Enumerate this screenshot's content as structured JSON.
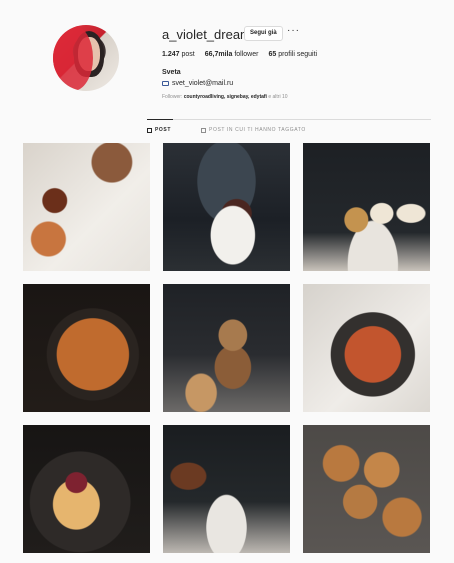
{
  "profile": {
    "username": "a_violet_dream",
    "follow_label": "Segui già",
    "more_label": "···",
    "stats": {
      "posts_value": "1.247",
      "posts_label": "post",
      "followers_value": "66,7mila",
      "followers_label": "follower",
      "following_value": "65",
      "following_label": "profili seguiti"
    },
    "full_name": "Sveta",
    "email": "svet_violet@mail.ru",
    "followed_by_prefix": "Follower:",
    "followed_by_names": "countyroadliving, signebay, edytafi",
    "followed_by_suffix": "e altri 10"
  },
  "tabs": {
    "posts": "POST",
    "tagged": "POST IN CUI TI HANNO TAGGATO"
  }
}
